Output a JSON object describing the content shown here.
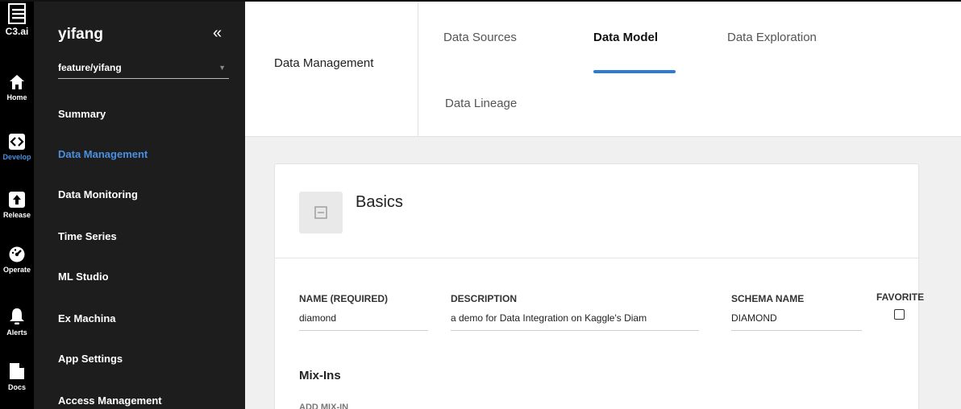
{
  "rail": {
    "logo_label": "C3.ai",
    "items": [
      {
        "label": "Home",
        "icon": "home-icon"
      },
      {
        "label": "Develop",
        "icon": "code-icon"
      },
      {
        "label": "Release",
        "icon": "upload-icon"
      },
      {
        "label": "Operate",
        "icon": "gauge-icon"
      },
      {
        "label": "Alerts",
        "icon": "bell-icon"
      },
      {
        "label": "Docs",
        "icon": "document-icon"
      }
    ]
  },
  "sidebar": {
    "title": "yifang",
    "collapse_glyph": "«",
    "branch": "feature/yifang",
    "items": [
      {
        "label": "Summary"
      },
      {
        "label": "Data Management"
      },
      {
        "label": "Data Monitoring"
      },
      {
        "label": "Time Series"
      },
      {
        "label": "ML Studio"
      },
      {
        "label": "Ex Machina"
      },
      {
        "label": "App Settings"
      },
      {
        "label": "Access Management"
      }
    ]
  },
  "header": {
    "section_title": "Data Management",
    "tabs": [
      {
        "label": "Data Sources"
      },
      {
        "label": "Data Model"
      },
      {
        "label": "Data Exploration"
      },
      {
        "label": "Data Lineage"
      }
    ]
  },
  "card": {
    "title": "Basics",
    "fields": {
      "name_label": "NAME (REQUIRED)",
      "name_value": "diamond",
      "description_label": "DESCRIPTION",
      "description_value": "a demo for Data Integration on Kaggle's Diam",
      "schema_label": "SCHEMA NAME",
      "schema_value": "DIAMOND",
      "favorite_label": "FAVORITE"
    },
    "mixins_title": "Mix-Ins",
    "mixins_sub": "ADD MIX-IN"
  },
  "colors": {
    "accent": "#2f7ad6",
    "active_text": "#4a90e2",
    "rail_bg": "#000000",
    "sidebar_bg": "#1d1d1d",
    "content_bg": "#f0f0f0"
  }
}
